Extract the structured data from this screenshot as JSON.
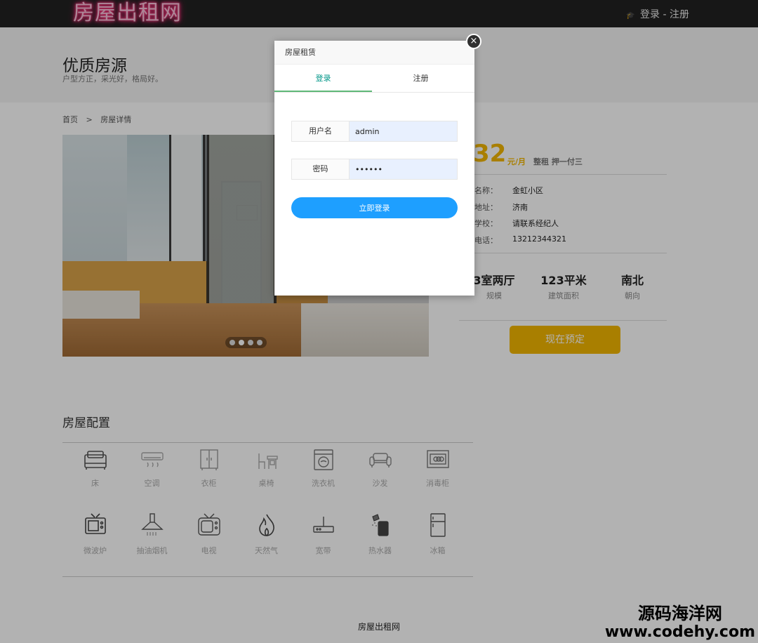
{
  "header": {
    "logo": "房屋出租网",
    "login": "登录",
    "separator": "-",
    "register": "注册"
  },
  "hero": {
    "title": "优质房源",
    "subtitle": "户型方正，采光好，格局好。"
  },
  "breadcrumb": {
    "home": "首页",
    "separator": ">",
    "current": "房屋详情"
  },
  "carousel": {
    "slides": 4,
    "active": 2
  },
  "listing": {
    "price": "32",
    "price_unit": "元/月",
    "rent_type": "整租 押一付三",
    "details": [
      {
        "label": "名称：",
        "value": "金虹小区"
      },
      {
        "label": "地址：",
        "value": "济南"
      },
      {
        "label": "学校：",
        "value": "请联系经纪人"
      },
      {
        "label": "电话：",
        "value": "13212344321"
      }
    ],
    "specs": [
      {
        "value": "3室两厅",
        "label": "规模"
      },
      {
        "value": "123平米",
        "label": "建筑面积"
      },
      {
        "value": "南北",
        "label": "朝向"
      }
    ],
    "book_button": "现在预定"
  },
  "amenities": {
    "title": "房屋配置",
    "items": [
      {
        "label": "床",
        "icon": "bed-icon"
      },
      {
        "label": "空调",
        "icon": "air-conditioner-icon"
      },
      {
        "label": "衣柜",
        "icon": "wardrobe-icon"
      },
      {
        "label": "桌椅",
        "icon": "desk-chair-icon"
      },
      {
        "label": "洗衣机",
        "icon": "washing-machine-icon"
      },
      {
        "label": "沙发",
        "icon": "sofa-icon"
      },
      {
        "label": "消毒柜",
        "icon": "sterilizer-icon"
      },
      {
        "label": "微波炉",
        "icon": "microwave-icon"
      },
      {
        "label": "抽油烟机",
        "icon": "range-hood-icon"
      },
      {
        "label": "电视",
        "icon": "tv-icon"
      },
      {
        "label": "天然气",
        "icon": "gas-flame-icon"
      },
      {
        "label": "宽带",
        "icon": "router-icon"
      },
      {
        "label": "热水器",
        "icon": "water-heater-icon"
      },
      {
        "label": "冰箱",
        "icon": "fridge-icon"
      }
    ]
  },
  "footer": {
    "text": "房屋出租网"
  },
  "watermark": {
    "line1": "源码海洋网",
    "line2": "www.codehy.com"
  },
  "modal": {
    "title": "房屋租赁",
    "close": "×",
    "tabs": [
      {
        "label": "登录",
        "active": true
      },
      {
        "label": "注册",
        "active": false
      }
    ],
    "username_label": "用户名",
    "username_value": "admin",
    "password_label": "密码",
    "password_value": "123456",
    "submit": "立即登录"
  },
  "colors": {
    "accent_yellow": "#f2b600",
    "login_blue": "#1e9fff",
    "tab_green": "#009688",
    "topbar": "#222222"
  }
}
